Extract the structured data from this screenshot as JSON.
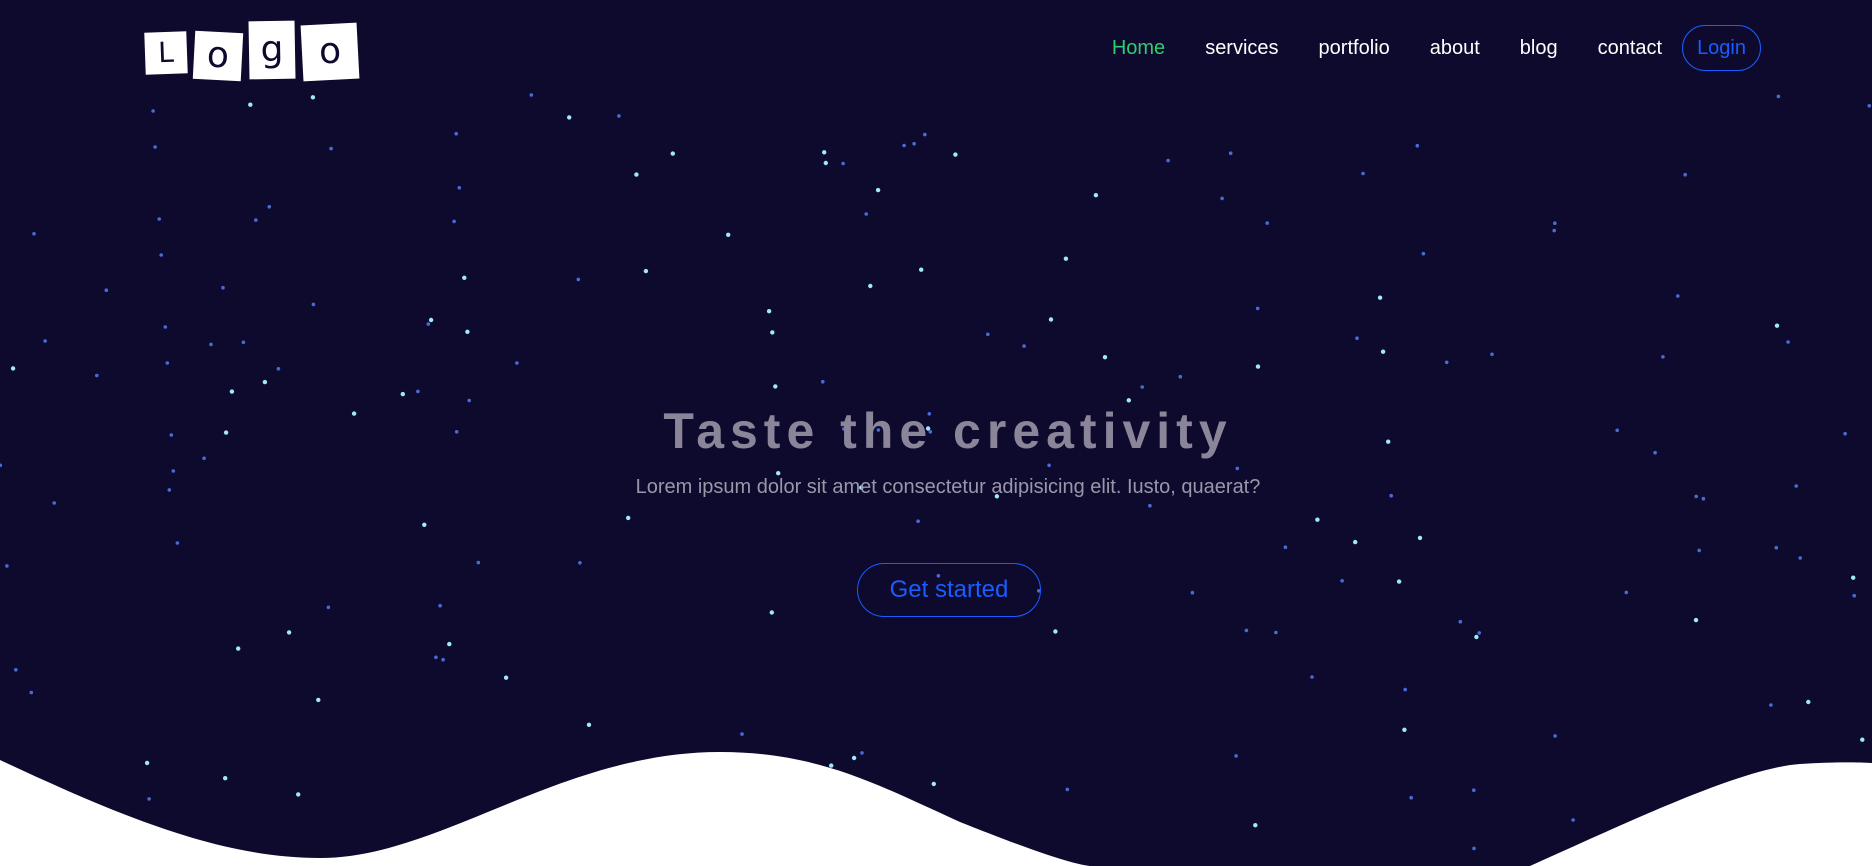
{
  "logo": {
    "letters": [
      "L",
      "o",
      "g",
      "o"
    ]
  },
  "nav": {
    "items": [
      {
        "label": "Home",
        "active": true
      },
      {
        "label": "services",
        "active": false
      },
      {
        "label": "portfolio",
        "active": false
      },
      {
        "label": "about",
        "active": false
      },
      {
        "label": "blog",
        "active": false
      },
      {
        "label": "contact",
        "active": false
      }
    ],
    "login_label": "Login"
  },
  "hero": {
    "headline": "Taste the creativity",
    "subtext": "Lorem ipsum dolor sit amet consectetur adipisicing elit. Iusto, quaerat?",
    "cta_label": "Get started"
  },
  "colors": {
    "background": "#0d0a2e",
    "accent_green": "#2ecc71",
    "accent_blue": "#1a5cff",
    "star_bright": "#9fe8ff",
    "star_dim": "#4a6bd6",
    "wave": "#ffffff"
  }
}
